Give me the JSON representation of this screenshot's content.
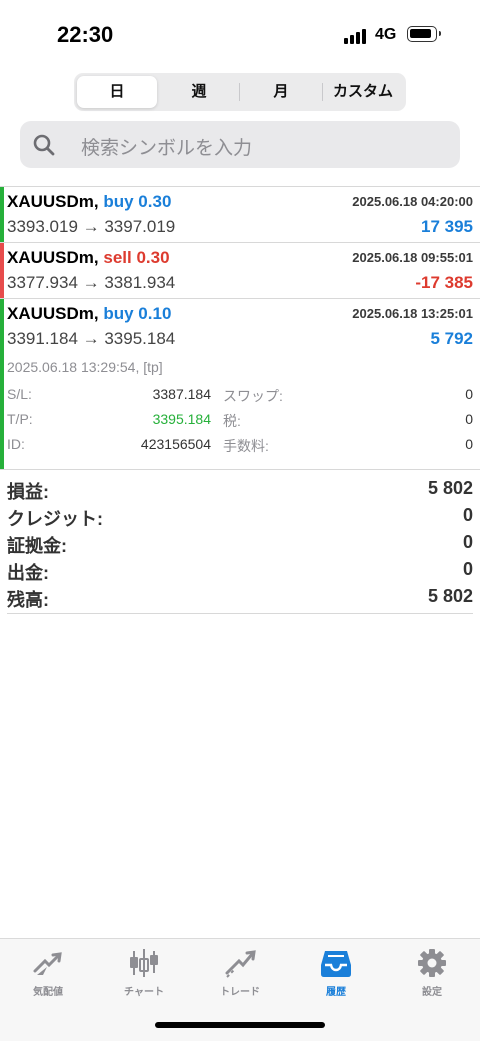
{
  "status": {
    "time": "22:30",
    "network": "4G"
  },
  "period_tabs": [
    {
      "label": "日",
      "active": true
    },
    {
      "label": "週",
      "active": false
    },
    {
      "label": "月",
      "active": false
    },
    {
      "label": "カスタム",
      "active": false
    }
  ],
  "search": {
    "placeholder": "検索シンボルを入力"
  },
  "trades": [
    {
      "symbol": "XAUUSDm,",
      "side": "buy 0.30",
      "datetime": "2025.06.18 04:20:00",
      "prices": "3393.019 → 3397.019",
      "profit": "17 395"
    },
    {
      "symbol": "XAUUSDm,",
      "side": "sell 0.30",
      "datetime": "2025.06.18 09:55:01",
      "prices": "3377.934 → 3381.934",
      "profit": "-17 385"
    },
    {
      "symbol": "XAUUSDm,",
      "side": "buy 0.10",
      "datetime": "2025.06.18 13:25:01",
      "prices": "3391.184 → 3395.184",
      "profit": "5 792",
      "detail": {
        "close_time": "2025.06.18 13:29:54, [tp]",
        "sl_label": "S/L:",
        "sl_value": "3387.184",
        "swap_label": "スワップ:",
        "swap_value": "0",
        "tp_label": "T/P:",
        "tp_value": "3395.184",
        "tax_label": "税:",
        "tax_value": "0",
        "id_label": "ID:",
        "id_value": "423156504",
        "fee_label": "手数料:",
        "fee_value": "0"
      }
    }
  ],
  "summary": [
    {
      "label": "損益:",
      "value": "5 802"
    },
    {
      "label": "クレジット:",
      "value": "0"
    },
    {
      "label": "証拠金:",
      "value": "0"
    },
    {
      "label": "出金:",
      "value": "0"
    },
    {
      "label": "残高:",
      "value": "5 802"
    }
  ],
  "tabbar": [
    {
      "label": "気配値",
      "icon": "quotes-icon",
      "active": false
    },
    {
      "label": "チャート",
      "icon": "chart-icon",
      "active": false
    },
    {
      "label": "トレード",
      "icon": "trade-icon",
      "active": false
    },
    {
      "label": "履歴",
      "icon": "history-icon",
      "active": true
    },
    {
      "label": "設定",
      "icon": "settings-icon",
      "active": false
    }
  ],
  "colors": {
    "accent": "#1a7fd9",
    "buy": "#26b03a",
    "sell": "#e74c4c"
  }
}
